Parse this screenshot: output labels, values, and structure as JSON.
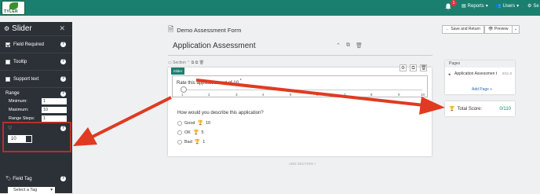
{
  "topbar": {
    "logo_text": "TYLER",
    "notification_count": "1",
    "reports_label": "Reports",
    "users_label": "Users",
    "settings_label": "Se"
  },
  "sidebar": {
    "title": "Slider",
    "field_required_label": "Field Required",
    "field_required_checked": true,
    "tooltip_label": "Tooltip",
    "support_text_label": "Support text",
    "range_label": "Range",
    "minimum_label": "Minimum:",
    "minimum_value": "1",
    "maximum_label": "Maximum:",
    "maximum_value": "10",
    "range_steps_label": "Range Steps:",
    "range_steps_value": "1",
    "score_weight_label": "Score Weight",
    "score_weight_value": "10",
    "field_tag_label": "Field Tag",
    "select_tag_label": "Select a Tag"
  },
  "header": {
    "form_name": "Demo Assessment Form",
    "save_return_label": "Save and Return",
    "preview_label": "Preview"
  },
  "main": {
    "title": "Application Assessment",
    "section_label": "Section",
    "slider_tag": "Slider",
    "rate_question": "Rate this application out of 10",
    "required_mark": "*",
    "ticks": [
      "1",
      "2",
      "3",
      "4",
      "5",
      "6",
      "7",
      "8",
      "9",
      "10"
    ],
    "describe_question": "How would you describe this application?",
    "options": [
      {
        "label": "Good",
        "score": "10"
      },
      {
        "label": "OK",
        "score": "5"
      },
      {
        "label": "Bad",
        "score": "1"
      }
    ],
    "add_section_label": "ADD SECTION +"
  },
  "pages_panel": {
    "header": "Pages",
    "page_name": "Application Assessmen t",
    "page_count": "0/11 0",
    "add_page_label": "Add Page +"
  },
  "total_score": {
    "label": "Total Score:",
    "value": "0/110"
  },
  "colors": {
    "topbar": "#1b7f6f",
    "sidebar": "#2c3138",
    "arrow": "#e03a22",
    "highlight_border": "#b4302a"
  }
}
